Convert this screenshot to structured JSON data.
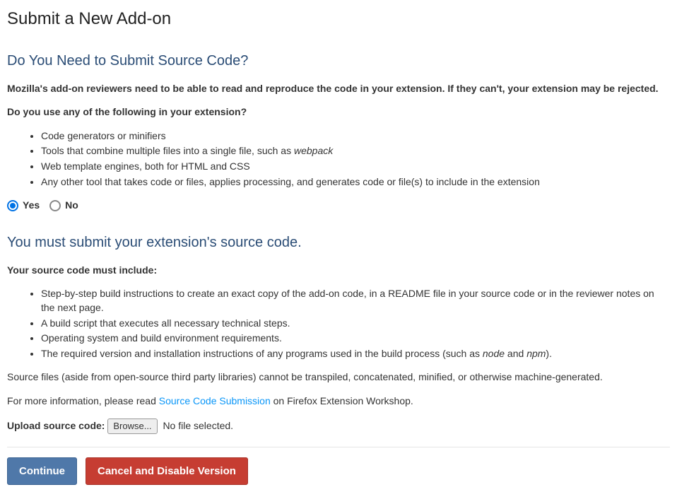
{
  "pageTitle": "Submit a New Add-on",
  "sectionA": {
    "heading": "Do You Need to Submit Source Code?",
    "intro": "Mozilla's add-on reviewers need to be able to read and reproduce the code in your extension. If they can't, your extension may be rejected.",
    "question": "Do you use any of the following in your extension?",
    "bulletsPrefix": [
      "Code generators or minifiers"
    ],
    "bullet2pre": "Tools that combine multiple files into a single file, such as ",
    "bullet2italic": "webpack",
    "bullets3": "Web template engines, both for HTML and CSS",
    "bullets4": "Any other tool that takes code or files, applies processing, and generates code or file(s) to include in the extension"
  },
  "radios": {
    "yes": "Yes",
    "no": "No"
  },
  "sectionB": {
    "heading": "You must submit your extension's source code.",
    "lead": "Your source code must include:",
    "items": [
      "Step-by-step build instructions to create an exact copy of the add-on code, in a README file in your source code or in the reviewer notes on the next page.",
      "A build script that executes all necessary technical steps.",
      "Operating system and build environment requirements."
    ],
    "item4pre": "The required version and installation instructions of any programs used in the build process (such as ",
    "item4it1": "node",
    "item4mid": " and ",
    "item4it2": "npm",
    "item4post": ").",
    "transpile": "Source files (aside from open-source third party libraries) cannot be transpiled, concatenated, minified, or otherwise machine-generated.",
    "moreInfoPre": "For more information, please read ",
    "moreInfoLink": "Source Code Submission",
    "moreInfoPost": " on Firefox Extension Workshop."
  },
  "upload": {
    "label": "Upload source code:",
    "browse": "Browse...",
    "noFile": "No file selected."
  },
  "buttons": {
    "continue": "Continue",
    "cancel": "Cancel and Disable Version"
  }
}
